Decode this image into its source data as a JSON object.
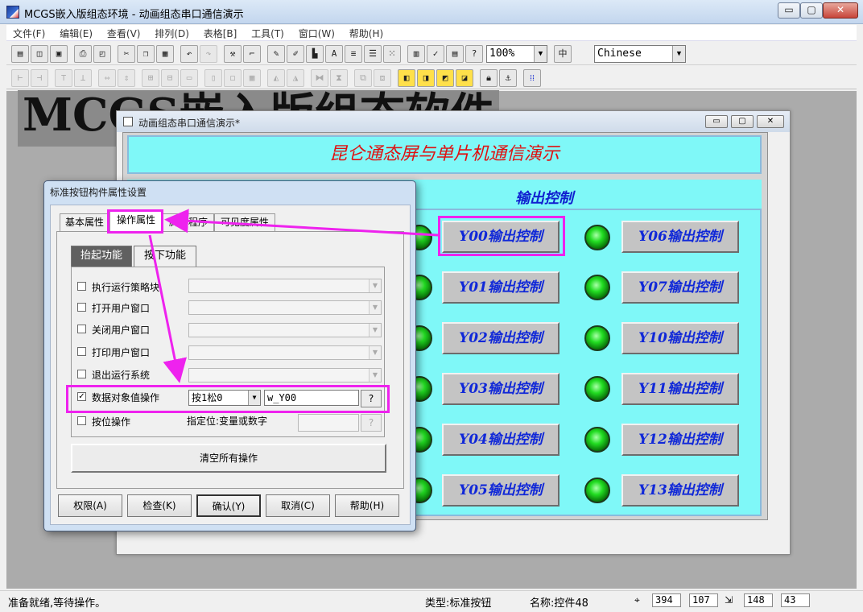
{
  "window": {
    "title": "MCGS嵌入版组态环境 - 动画组态串口通信演示",
    "min_glyph": "▭",
    "max_glyph": "▢",
    "close_glyph": "✕"
  },
  "menu": [
    "文件(F)",
    "编辑(E)",
    "查看(V)",
    "排列(D)",
    "表格[B]",
    "工具(T)",
    "窗口(W)",
    "帮助(H)"
  ],
  "toolbar": {
    "zoom_value": "100%",
    "language_value": "Chinese"
  },
  "background_banner": "MCGS嵌入版组态软件",
  "child_window": {
    "title": "动画组态串口通信演示*",
    "demo_title": "昆仑通态屏与单片机通信演示",
    "output_label": "输出控制",
    "buttons_left": [
      "Y00输出控制",
      "Y01输出控制",
      "Y02输出控制",
      "Y03输出控制",
      "Y04输出控制",
      "Y05输出控制"
    ],
    "buttons_right": [
      "Y06输出控制",
      "Y07输出控制",
      "Y10输出控制",
      "Y11输出控制",
      "Y12输出控制",
      "Y13输出控制"
    ]
  },
  "dialog": {
    "title": "标准按钮构件属性设置",
    "tabs": [
      "基本属性",
      "操作属性",
      "脚本程序",
      "可见度属性"
    ],
    "subtabs": [
      "抬起功能",
      "按下功能"
    ],
    "rows": [
      {
        "label": "执行运行策略块",
        "checked": false
      },
      {
        "label": "打开用户窗口",
        "checked": false
      },
      {
        "label": "关闭用户窗口",
        "checked": false
      },
      {
        "label": "打印用户窗口",
        "checked": false
      },
      {
        "label": "退出运行系统",
        "checked": false
      }
    ],
    "data_op": {
      "label": "数据对象值操作",
      "checked": true,
      "mode": "按1松0",
      "variable": "w_Y00",
      "browse": "?"
    },
    "bit_op": {
      "label": "按位操作",
      "checked": false,
      "hint": "指定位:变量或数字",
      "browse": "?"
    },
    "clear_button": "清空所有操作",
    "footer_buttons": [
      "权限(A)",
      "检查(K)",
      "确认(Y)",
      "取消(C)",
      "帮助(H)"
    ]
  },
  "status": {
    "message": "准备就绪,等待操作。",
    "type": "类型:标准按钮",
    "name": "名称:控件48",
    "x": "394",
    "y": "107",
    "w": "148",
    "h": "43"
  },
  "colors": {
    "accent_highlight": "#ee22ee",
    "panel_bg": "#7ff8f8",
    "demo_title_text": "#e01010",
    "button_text": "#1028d8",
    "led": "#22dd22"
  },
  "icons": [
    "app-logo-icon",
    "new-window-icon",
    "open-icon",
    "save-icon",
    "print-icon",
    "print-preview-icon",
    "cut-icon",
    "copy-icon",
    "paste-icon",
    "undo-icon",
    "redo-icon",
    "tools-icon",
    "help-cursor-icon",
    "lock-icon",
    "grid-icon"
  ]
}
